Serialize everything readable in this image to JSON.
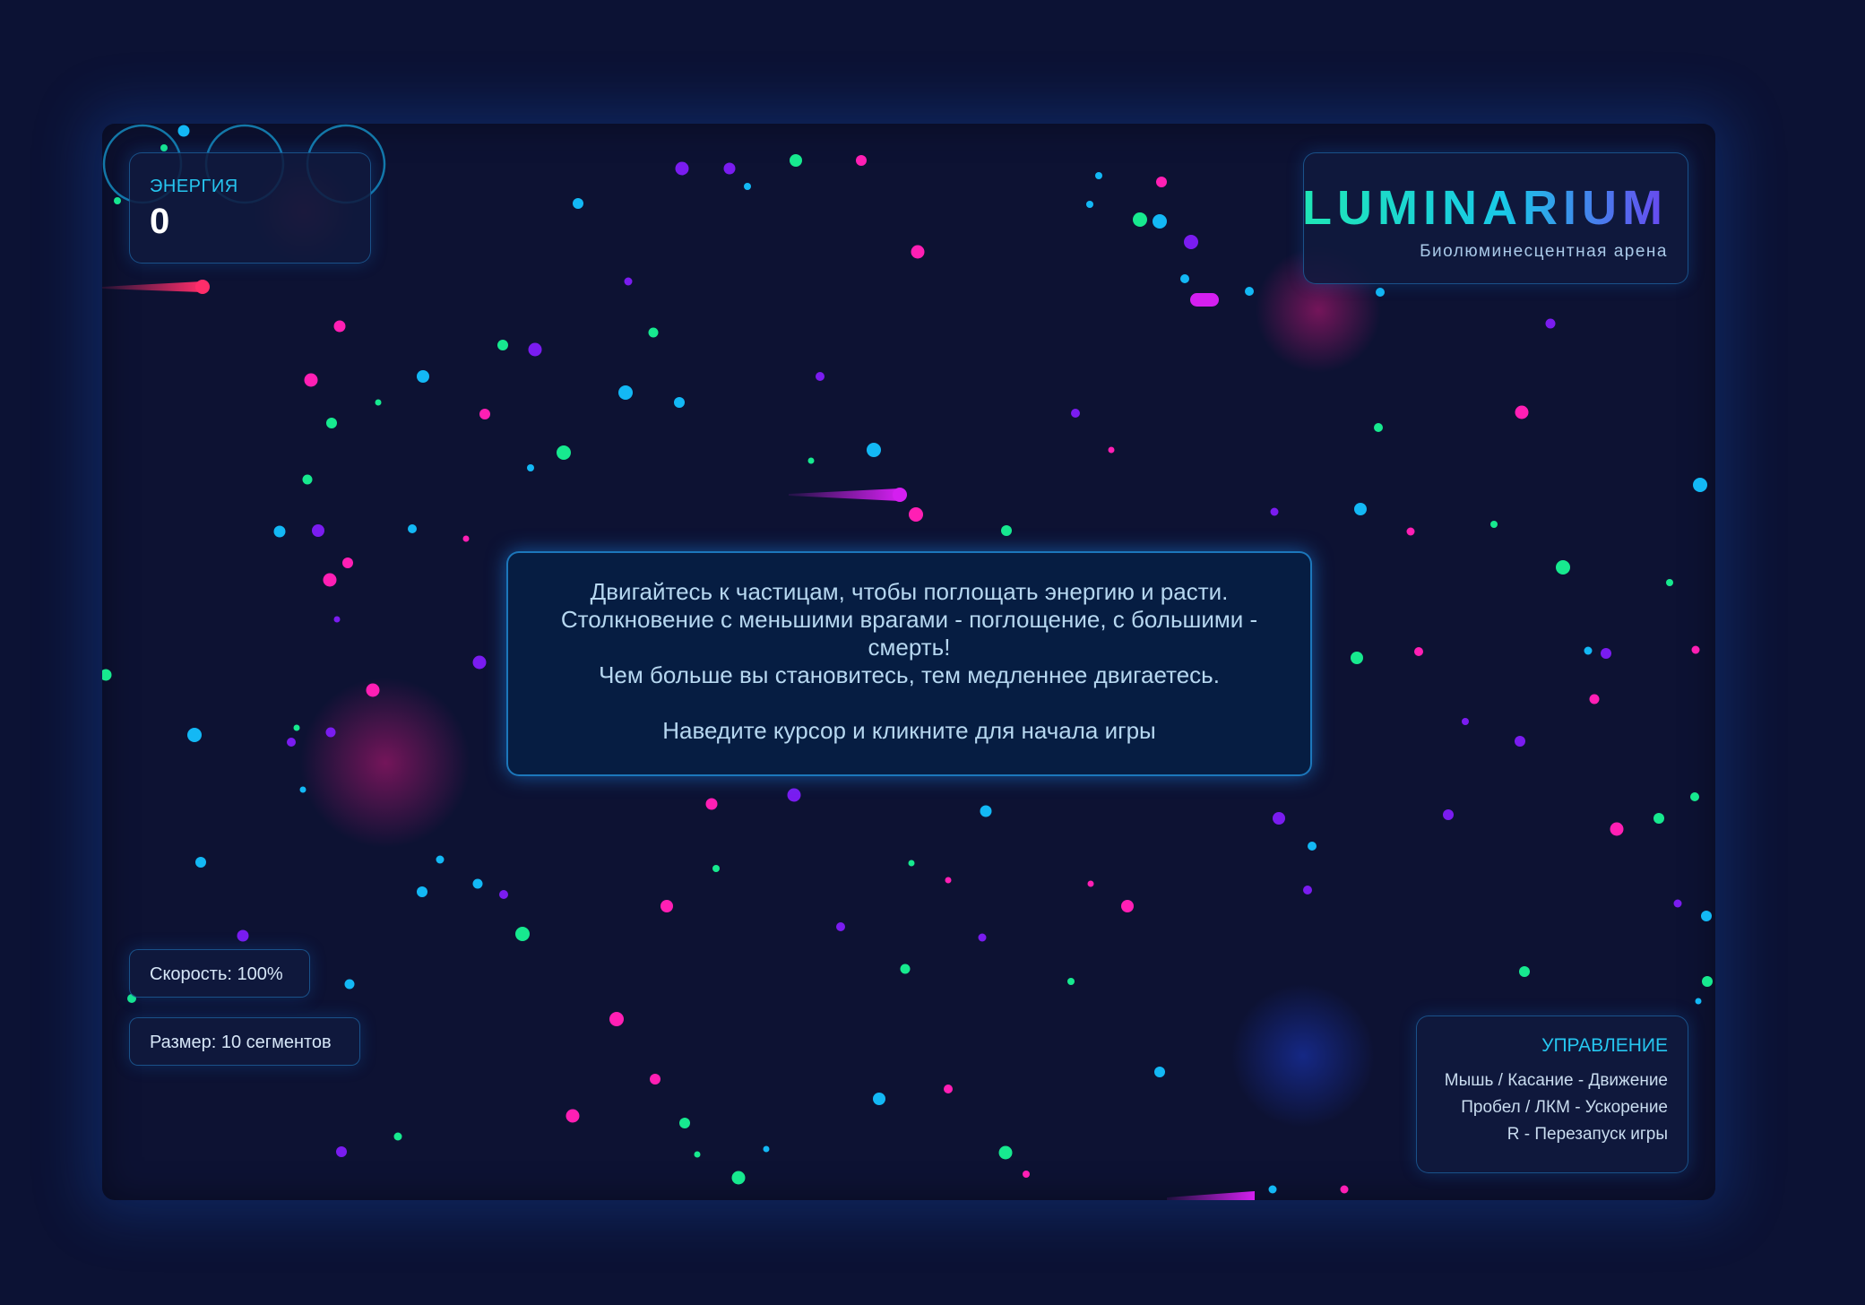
{
  "hud": {
    "energy_label": "ЭНЕРГИЯ",
    "energy_value": "0"
  },
  "title": {
    "name": "LUMINARIUM",
    "subtitle": "Биолюминесцентная арена",
    "gradient_colors": [
      "#1fe6b6",
      "#19c9e8",
      "#6a46f0"
    ]
  },
  "intro": {
    "line1": "Двигайтесь к частицам, чтобы поглощать энергию и расти.",
    "line2": "Столкновение с меньшими врагами - поглощение, с большими - смерть!",
    "line3": "Чем больше вы становитесь, тем медленнее двигаетесь.",
    "prompt": "Наведите курсор и кликните для начала игры"
  },
  "stats": {
    "speed": "Скорость: 100%",
    "size": "Размер: 10 сегментов"
  },
  "controls": {
    "title": "УПРАВЛЕНИЕ",
    "lines": [
      "Мышь / Касание - Движение",
      "Пробел / ЛКМ - Ускорение",
      "R - Перезапуск игры"
    ]
  },
  "palette": {
    "background": "#0d1233",
    "particle_colors": [
      "#ff1fb4",
      "#17e98f",
      "#13b8f5",
      "#7a1cf0"
    ],
    "enemy_colors": [
      "#ff2d6a",
      "#d41ff0"
    ]
  }
}
